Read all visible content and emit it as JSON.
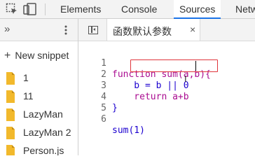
{
  "toolbar": {
    "tabs": [
      "Elements",
      "Console",
      "Sources",
      "Netw"
    ],
    "active_tab": "Sources",
    "accent": "#1a73e8"
  },
  "navigator": {
    "more_label": "»",
    "new_snippet": "New snippet",
    "snippets": [
      "1",
      "11",
      "LazyMan",
      "LazyMan 2",
      "Person.js"
    ]
  },
  "editor": {
    "file_tab": "函数默认参数",
    "close": "×",
    "lines": [
      {
        "num": "1",
        "text": "function sum(a,b){"
      },
      {
        "num": "2",
        "text": "    b = b || 0"
      },
      {
        "num": "3",
        "text": "    return a+b"
      },
      {
        "num": "4",
        "text": "}"
      },
      {
        "num": "5",
        "text": ""
      },
      {
        "num": "6",
        "text": "sum(1)"
      }
    ],
    "highlight_color": "#e0353b"
  }
}
